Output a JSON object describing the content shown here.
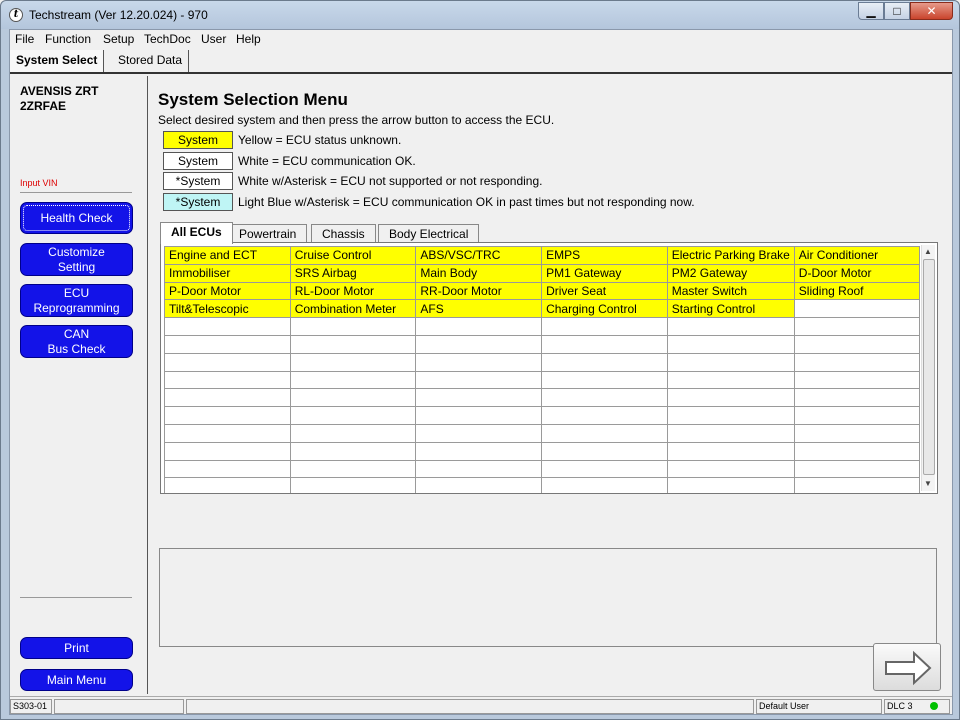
{
  "window": {
    "title": "Techstream (Ver 12.20.024) - 970",
    "minimize": "▁",
    "maximize": "□",
    "close": "✕"
  },
  "menubar": [
    "File",
    "Function",
    "Setup",
    "TechDoc",
    "User",
    "Help"
  ],
  "top_tabs": {
    "system_select": "System Select",
    "stored_data": "Stored Data"
  },
  "sidebar": {
    "vehicle_model": "AVENSIS ZRT",
    "vehicle_engine": "2ZRFAE",
    "input_vin": "Input VIN",
    "health_check": "Health Check",
    "customize_setting": "Customize\nSetting",
    "ecu_reprogramming": "ECU\nReprogramming",
    "can_bus_check": "CAN\nBus Check",
    "print": "Print",
    "main_menu": "Main Menu"
  },
  "main": {
    "title": "System Selection Menu",
    "instruction": "Select desired system and then press the arrow button to access the ECU.",
    "legend": [
      {
        "box": "System",
        "text": "Yellow = ECU status unknown.",
        "color": "#ffff00"
      },
      {
        "box": "System",
        "text": "White = ECU communication OK.",
        "color": "#ffffff"
      },
      {
        "box": "*System",
        "text": "White w/Asterisk = ECU not supported or not responding.",
        "color": "#ffffff"
      },
      {
        "box": "*System",
        "text": "Light Blue w/Asterisk = ECU communication OK in past times but not responding now.",
        "color": "#bff5f5"
      }
    ],
    "category_tabs": [
      "All ECUs",
      "Powertrain",
      "Chassis",
      "Body Electrical"
    ],
    "ecu_rows": [
      [
        "Engine and ECT",
        "Cruise Control",
        "ABS/VSC/TRC",
        "EMPS",
        "Electric Parking Brake",
        "Air Conditioner"
      ],
      [
        "Immobiliser",
        "SRS Airbag",
        "Main Body",
        "PM1 Gateway",
        "PM2 Gateway",
        "D-Door Motor"
      ],
      [
        "P-Door Motor",
        "RL-Door Motor",
        "RR-Door Motor",
        "Driver Seat",
        "Master Switch",
        "Sliding Roof"
      ],
      [
        "Tilt&Telescopic",
        "Combination Meter",
        "AFS",
        "Charging Control",
        "Starting Control",
        ""
      ]
    ],
    "empty_rows": 10
  },
  "statusbar": {
    "code": "S303-01",
    "user": "Default User",
    "dlc": "DLC 3"
  },
  "colors": {
    "unknown_status": "#ffff00",
    "button_blue": "#1313e8",
    "dlc_ok": "#00c000"
  }
}
